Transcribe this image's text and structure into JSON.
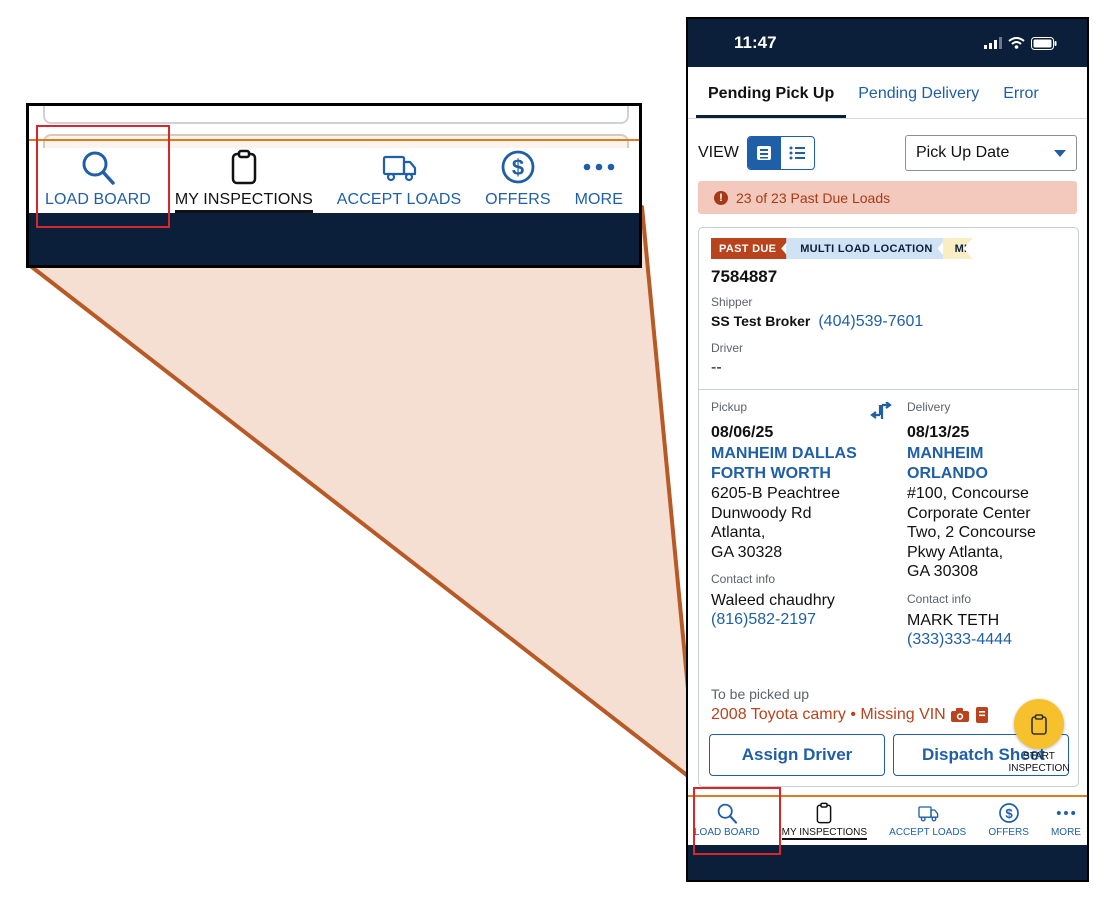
{
  "status_bar": {
    "time": "11:47"
  },
  "tabs": [
    {
      "label": "Pending Pick Up",
      "active": true
    },
    {
      "label": "Pending Delivery",
      "active": false
    },
    {
      "label": "Error",
      "active": false
    }
  ],
  "view": {
    "label": "VIEW",
    "sort_value": "Pick Up Date"
  },
  "alert": {
    "text": "23 of 23 Past Due Loads"
  },
  "card": {
    "badges": [
      "PAST DUE",
      "MULTI LOAD LOCATION",
      "MIS"
    ],
    "load_number": "7584887",
    "shipper_label": "Shipper",
    "shipper_name": "SS Test Broker",
    "shipper_phone": "(404)539-7601",
    "driver_label": "Driver",
    "driver_value": "--",
    "pickup": {
      "label": "Pickup",
      "date": "08/06/25",
      "place_lines": [
        "MANHEIM DALLAS",
        "FORTH WORTH"
      ],
      "address_lines": [
        "6205-B Peachtree",
        "Dunwoody Rd",
        "Atlanta,",
        "GA 30328"
      ],
      "contact_label": "Contact info",
      "contact_name": "Waleed chaudhry",
      "contact_phone": "(816)582-2197"
    },
    "delivery": {
      "label": "Delivery",
      "date": "08/13/25",
      "place_lines": [
        "MANHEIM",
        "ORLANDO"
      ],
      "address_lines": [
        "#100, Concourse",
        "Corporate Center",
        "Two, 2 Concourse",
        "Pkwy Atlanta,",
        "GA 30308"
      ],
      "contact_label": "Contact info",
      "contact_name": "MARK TETH",
      "contact_phone": "(333)333-4444"
    },
    "to_be_label": "To be picked up",
    "vehicle": "2008 Toyota camry • Missing VIN",
    "assign_label": "Assign Driver",
    "dispatch_label": "Dispatch Sheet"
  },
  "fab": {
    "label_line1": "START",
    "label_line2": "INSPECTION"
  },
  "nav": [
    {
      "label": "LOAD BOARD",
      "icon": "search-icon"
    },
    {
      "label": "MY INSPECTIONS",
      "icon": "clipboard-icon",
      "active": true
    },
    {
      "label": "ACCEPT LOADS",
      "icon": "truck-icon"
    },
    {
      "label": "OFFERS",
      "icon": "dollar-icon"
    },
    {
      "label": "MORE",
      "icon": "more-icon"
    }
  ],
  "colors": {
    "primary": "#1f5fa8",
    "navy": "#0b1f3a",
    "past_due": "#b8431d",
    "accent": "#e07a1f",
    "fab": "#f6c12d",
    "highlight": "#d8272a"
  }
}
